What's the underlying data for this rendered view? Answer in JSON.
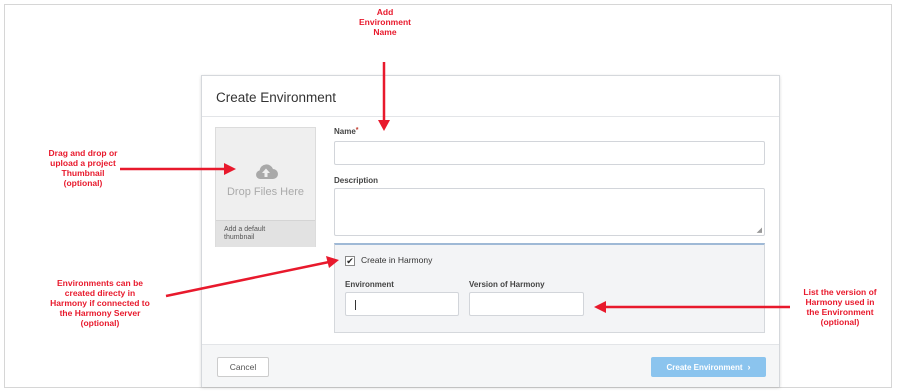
{
  "dialog": {
    "title": "Create Environment",
    "thumbnail": {
      "icon": "cloud-upload-icon",
      "drop_text": "Drop Files Here",
      "default_label": "Add a default thumbnail"
    },
    "name": {
      "label": "Name",
      "required_marker": "*",
      "value": ""
    },
    "description": {
      "label": "Description",
      "value": ""
    },
    "harmony": {
      "checkbox_label": "Create in Harmony",
      "checked": true,
      "environment_label": "Environment",
      "environment_value": "",
      "version_label": "Version of Harmony",
      "version_value": ""
    },
    "cancel_label": "Cancel",
    "create_label": "Create Environment",
    "create_chevron": "›"
  },
  "annotations": {
    "name": [
      "Add",
      "Environment",
      "Name"
    ],
    "thumbnail": [
      "Drag and drop or",
      "upload a project",
      "Thumbnail",
      "(optional)"
    ],
    "harmony": [
      "Environments can be",
      "created directy in",
      "Harmony if connected to",
      "the Harmony Server",
      "(optional)"
    ],
    "version": [
      "List the version of",
      "Harmony used in",
      "the Environment",
      "(optional)"
    ]
  },
  "colors": {
    "annotation": "#e8192c",
    "primary_button": "#8bc4ee",
    "panel_bg": "#f3f4f6"
  }
}
